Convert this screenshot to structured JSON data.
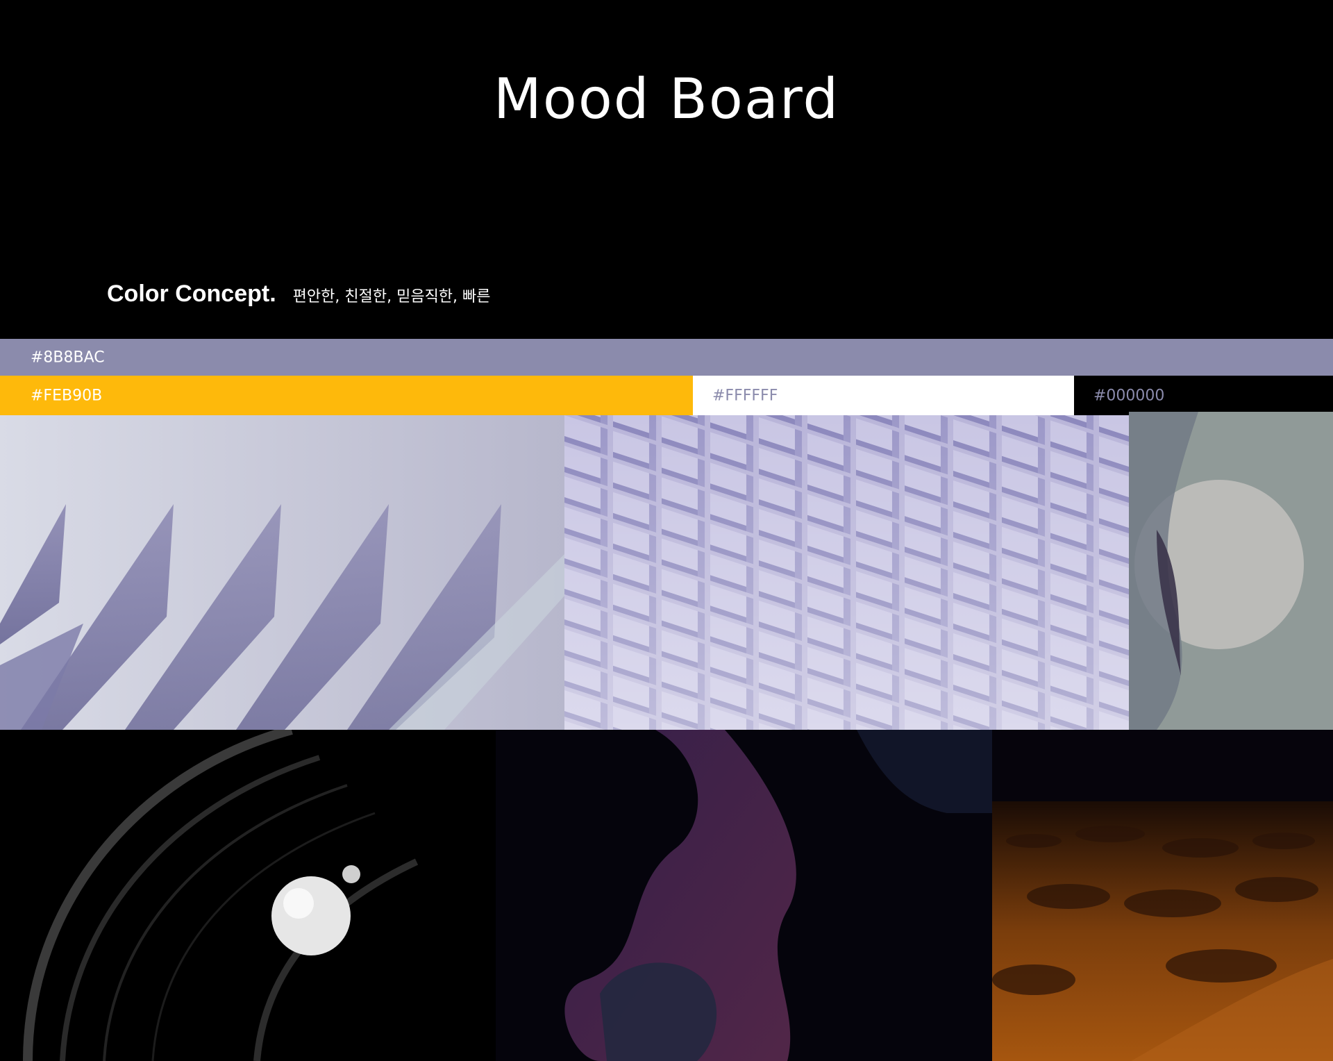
{
  "title": "Mood Board",
  "color_concept": {
    "heading": "Color Concept.",
    "keywords": "편안한, 친절한, 믿음직한, 빠른"
  },
  "swatches": {
    "lavender": {
      "label": "#8B8BAC",
      "color": "#8B8BAC"
    },
    "yellow": {
      "label": "#FEB90B",
      "color": "#FEB90B"
    },
    "white": {
      "label": "#FFFFFF",
      "color": "#FFFFFF"
    },
    "black": {
      "label": "#000000",
      "color": "#000000"
    }
  },
  "images": [
    {
      "name": "lavender-glass-spikes"
    },
    {
      "name": "lavender-block-wall"
    },
    {
      "name": "translucent-circle-shape"
    },
    {
      "name": "black-rings-white-sphere"
    },
    {
      "name": "dark-purple-fluid"
    },
    {
      "name": "orange-sand-dunes"
    }
  ]
}
